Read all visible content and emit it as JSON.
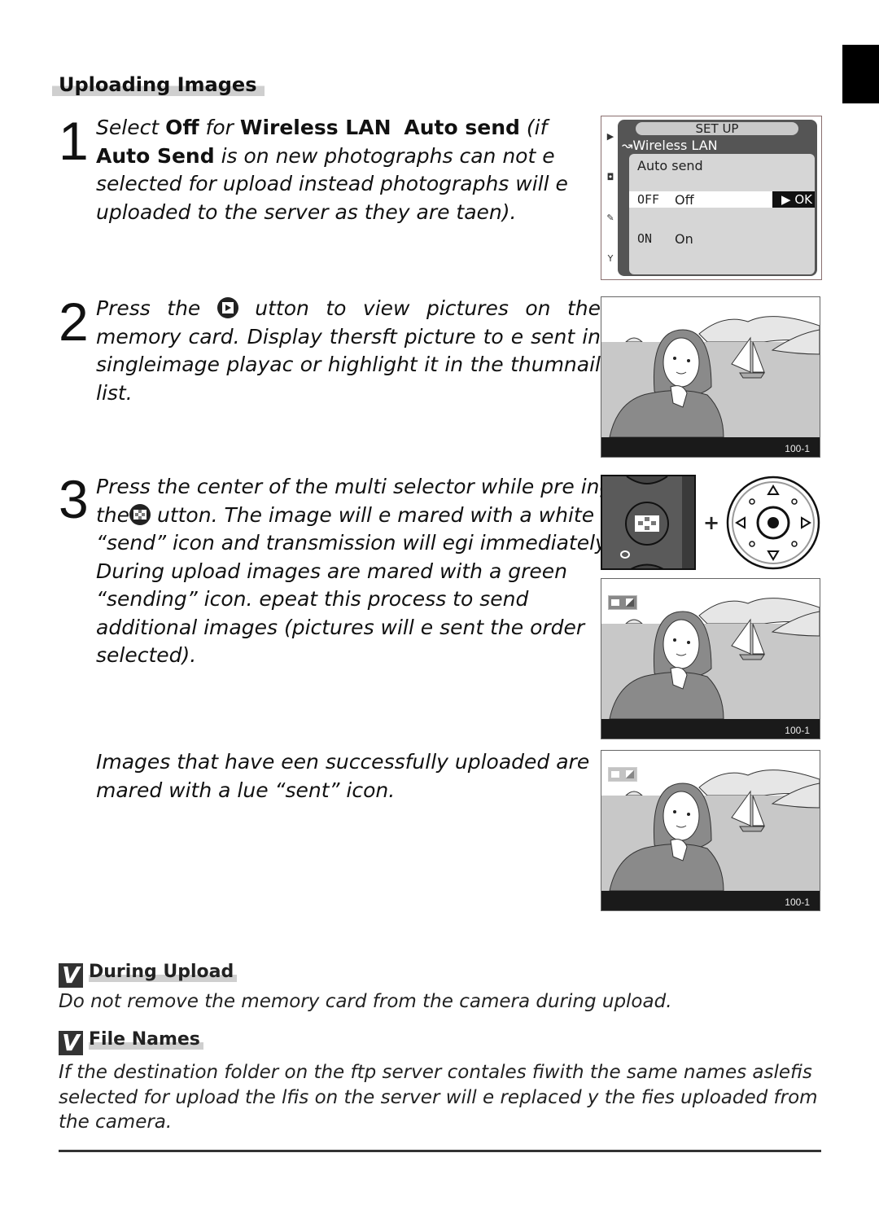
{
  "section": {
    "title": "Uploading Images"
  },
  "steps": [
    {
      "number": "1",
      "parts": {
        "a": "Select ",
        "b_off": "Off",
        "c": " for ",
        "d_wlan": "Wireless LAN",
        "e_autosend": "Auto send",
        "f": " (if ",
        "g_autosend2": "Auto Send",
        "h": " is on new photographs can not e selected for upload instead photographs will e uploaded to the server as they are taen)."
      }
    },
    {
      "number": "2",
      "parts": {
        "a": "Press the ",
        "icon": "playback-button-icon",
        "b": " utton to view pictures on the memory card. Display thersft picture to e sent in singleimage playac or highlight it in the thumnail list."
      }
    },
    {
      "number": "3",
      "parts": {
        "a": "Press the center of the multi selector while pre ing the",
        "icon": "thumbnail-button-icon",
        "b": " utton. The image will e mared with a white “send” icon and transmission will egi immediately. During upload images are mared with a green “sending” icon. epeat this process to send additional images (pictures will e sent the order selected)."
      }
    }
  ],
  "note_text": "Images that have een successfully uploaded are mared with a lue “sent” icon.",
  "menu_screen": {
    "header": "SET UP",
    "breadcrumb": "Wireless LAN",
    "breadcrumb_icon": "wireless-icon",
    "panel_title": "Auto send",
    "options": [
      {
        "code": "OFF",
        "label": "Off",
        "selected": true,
        "action": "▶ OK"
      },
      {
        "code": "ON",
        "label": "On",
        "selected": false
      }
    ],
    "side_tabs": [
      "playback-menu-icon",
      "shooting-menu-icon",
      "custom-settings-icon",
      "setup-menu-icon"
    ]
  },
  "photos": [
    {
      "frame_number": "100-1",
      "badge": ""
    },
    {
      "frame_number": "100-1",
      "badge": "sending-icon"
    },
    {
      "frame_number": "100-1",
      "badge": "sent-icon"
    }
  ],
  "illustration": {
    "plus": "+"
  },
  "notes": [
    {
      "title": "During Upload",
      "icon": "check-v-icon",
      "body": "Do not remove the memory card from the camera during upload."
    },
    {
      "title": "File Names",
      "icon": "check-v-icon",
      "body": "If the destination folder on the ftp server contales fiwith the same names aslefis selected for upload the lfis on the server will e replaced y the fies uploaded from the camera."
    }
  ],
  "colors": {
    "text": "#111111",
    "highlight": "#cfcfcf",
    "tab": "#000000",
    "menu_bg": "#555555",
    "panel_bg": "#d6d6d6"
  }
}
